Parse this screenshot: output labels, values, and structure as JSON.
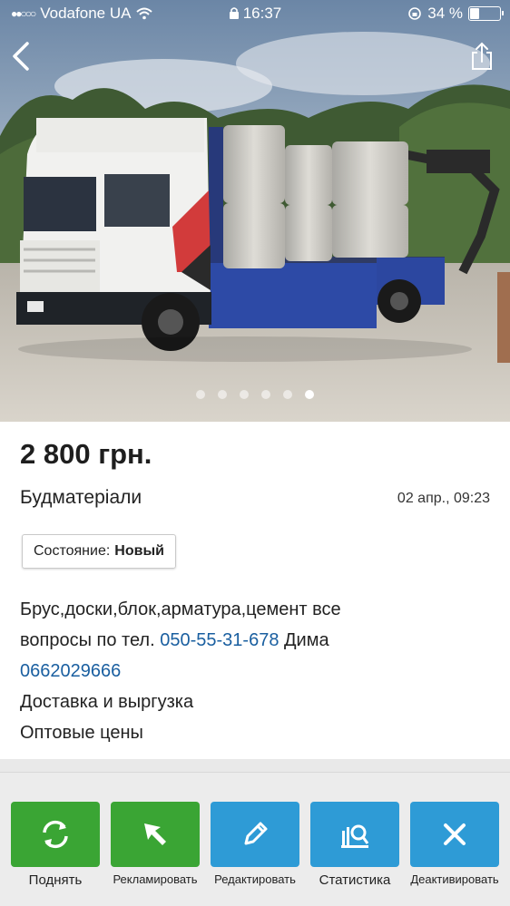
{
  "status_bar": {
    "carrier": "Vodafone UA",
    "time": "16:37",
    "battery": "34 %",
    "battery_level": 0.34
  },
  "gallery": {
    "photo_count": 6,
    "active_index": 5
  },
  "listing": {
    "price": "2 800 грн.",
    "category": "Будматеріали",
    "date": "02 апр., 09:23",
    "condition_label": "Состояние:",
    "condition_value": "Новый",
    "description": {
      "line1": "Брус,доски,блок,арматура,цемент все",
      "line2_prefix": "вопросы по тел.",
      "phone1": "050-55-31-678",
      "line2_suffix": "Дима",
      "phone2": "0662029666",
      "line4": "Доставка и выргузка",
      "line5": "Оптовые цены"
    }
  },
  "actions": [
    {
      "label": "Поднять",
      "icon": "refresh-icon",
      "color": "#3aa534"
    },
    {
      "label": "Рекламировать",
      "icon": "cursor-arrow-icon",
      "color": "#3aa534"
    },
    {
      "label": "Редактировать",
      "icon": "pencil-icon",
      "color": "#2e9bd6"
    },
    {
      "label": "Статистика",
      "icon": "statistics-icon",
      "color": "#2e9bd6"
    },
    {
      "label": "Деактивировать",
      "icon": "close-icon",
      "color": "#2e9bd6"
    }
  ]
}
